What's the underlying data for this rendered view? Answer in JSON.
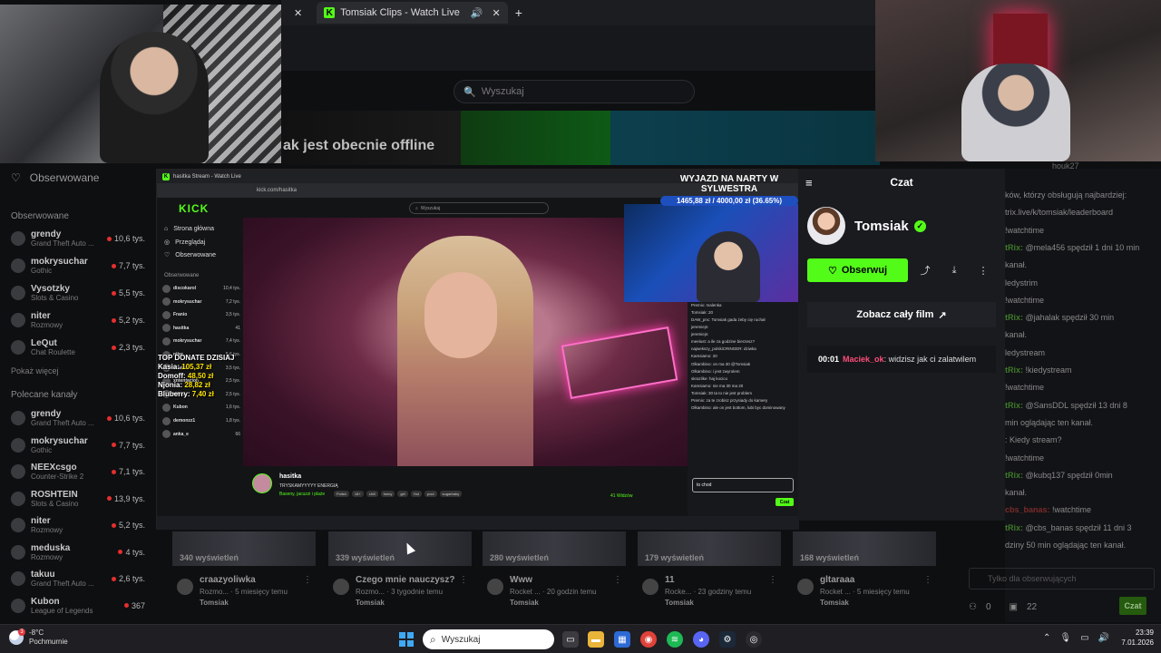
{
  "browser": {
    "tab_title": "Tomsiak Clips - Watch Live",
    "search_placeholder": "Wyszukaj",
    "offline_text": "ak jest obecnie offline"
  },
  "sidebar": {
    "following_header": "Obserwowane",
    "following_section": "Obserwowane",
    "following": [
      {
        "name": "grendy",
        "game": "Grand Theft Auto ...",
        "viewers": "10,6 tys."
      },
      {
        "name": "mokrysuchar",
        "game": "Gothic",
        "viewers": "7,7 tys."
      },
      {
        "name": "Vysotzky",
        "game": "Slots & Casino",
        "viewers": "5,5 tys."
      },
      {
        "name": "niter",
        "game": "Rozmowy",
        "viewers": "5,2 tys."
      },
      {
        "name": "LeQut",
        "game": "Chat Roulette",
        "viewers": "2,3 tys."
      }
    ],
    "show_more": "Pokaż więcej",
    "recommended_section": "Polecane kanały",
    "recommended": [
      {
        "name": "grendy",
        "game": "Grand Theft Auto ...",
        "viewers": "10,6 tys."
      },
      {
        "name": "mokrysuchar",
        "game": "Gothic",
        "viewers": "7,7 tys."
      },
      {
        "name": "NEEXcsgo",
        "game": "Counter-Strike 2",
        "viewers": "7,1 tys."
      },
      {
        "name": "ROSHTEIN",
        "game": "Slots & Casino",
        "viewers": "13,9 tys."
      },
      {
        "name": "niter",
        "game": "Rozmowy",
        "viewers": "5,2 tys."
      },
      {
        "name": "meduska",
        "game": "Rozmowy",
        "viewers": "4 tys."
      },
      {
        "name": "takuu",
        "game": "Grand Theft Auto ...",
        "viewers": "2,6 tys."
      },
      {
        "name": "Kubon",
        "game": "League of Legends",
        "viewers": "367"
      }
    ]
  },
  "inner": {
    "tab": "hasitka Stream - Watch Live",
    "url": "kick.com/hasitka",
    "logo": "KICK",
    "search": "Wyszukaj",
    "nav": [
      "Strona główna",
      "Przeglądaj",
      "Obserwowane"
    ],
    "section": "Obserwowane",
    "items": [
      {
        "name": "discokarol",
        "vw": "10,4 tys."
      },
      {
        "name": "mokrysuchar",
        "vw": "7,2 tys."
      },
      {
        "name": "Franio",
        "vw": "3,5 tys."
      },
      {
        "name": "hasitka",
        "vw": "41"
      },
      {
        "name": "mokrysuchar",
        "vw": "7,4 tys."
      },
      {
        "name": "niter",
        "vw": "5,6 tys."
      },
      {
        "name": "Franio",
        "vw": "3,5 tys."
      },
      {
        "name": "xntentacion",
        "vw": "2,5 tys."
      },
      {
        "name": "takuu",
        "vw": "2,5 tys."
      },
      {
        "name": "Kubon",
        "vw": "1,6 tys."
      },
      {
        "name": "demonzz1",
        "vw": "1,8 tys."
      },
      {
        "name": "anka_e",
        "vw": "66"
      }
    ],
    "streamer": "hasitka",
    "stream_title": "TRYSKAMYYYYY ENERGIĄ",
    "category": "Baseny, jacuzzi i plaże",
    "tags": [
      "Polish",
      "18+",
      "chill",
      "funny",
      "girl",
      "Hot",
      "pool",
      "sugarbaby"
    ],
    "viewers": "41 Widzów",
    "chat": [
      "Premix: malenka",
      "Tomsiak: 20",
      "DAW_pnc: Tomsiak gada żeby cię ruchał",
      "jeremiejn:",
      "jeremiejn:",
      "meelust: a ile za godzine bierzesz?",
      "najwekszy_polskiCRINGER: dziwka",
      "Kamsiamo: 20",
      "Olkambino: on ma 30 @Tomsiak",
      "Olkambino: i jest zwyrolem",
      "skrazlike: haj kocico",
      "Kamsiamo: nie ma 30 ma 20",
      "Tomsiak: 30 ta to nie jest problem",
      "Premix: za te zrobisz przysiady do kamery",
      "Olkambino: ale on jest bottom, lubi byc dominowany"
    ],
    "chat_input": "to chod",
    "chat_send": "Czat"
  },
  "donate": {
    "title": "TOP DONATE DZISIAJ",
    "rows": [
      {
        "name": "Kasia:",
        "value": "105,37 zł"
      },
      {
        "name": "Domoff:",
        "value": "48,50 zł"
      },
      {
        "name": "Njonia:",
        "value": "28,82 zł"
      },
      {
        "name": "Bluberry:",
        "value": "7,40 zł"
      }
    ]
  },
  "goal": {
    "title": "WYJAZD NA NARTY W SYLWESTRA",
    "progress_text": "1465,88 zł / 4000,00 zł (36.65%)"
  },
  "chatpanel": {
    "title": "Czat",
    "channel": "Tomsiak",
    "follow": "Obserwuj",
    "full_video": "Zobacz cały film",
    "message_time": "00:01",
    "message_user": "Maciek_ok",
    "message_text": ": widzisz jak ci zalatwilem"
  },
  "rightchat": {
    "user_top": "houk27",
    "lines": [
      {
        "u": "",
        "t": "ków, którzy obsługują najbardziej:"
      },
      {
        "u": "",
        "t": "trix.live/k/tomsiak/leaderboard"
      },
      {
        "u": "",
        "t": "!watchtime"
      },
      {
        "u": "tRix:",
        "t": " @mela456 spędził 1 dni 10 min"
      },
      {
        "u": "",
        "t": "kanał."
      },
      {
        "u": "",
        "t": "ledystrim"
      },
      {
        "u": "",
        "t": "!watchtime"
      },
      {
        "u": "tRix:",
        "t": " @jahalak spędził 30 min"
      },
      {
        "u": "",
        "t": "kanał."
      },
      {
        "u": "",
        "t": "ledystream"
      },
      {
        "u": "tRix:",
        "t": " !kiedystream"
      },
      {
        "u": "",
        "t": "!watchtime"
      },
      {
        "u": "tRix:",
        "t": " @SansDDL spędził 13 dni 8"
      },
      {
        "u": "",
        "t": "min oglądając ten kanał."
      },
      {
        "u": "",
        "t": ": Kiedy stream?"
      },
      {
        "u": "",
        "t": "!watchtime"
      },
      {
        "u": "tRix:",
        "t": " @kubq137 spędził 0min"
      },
      {
        "u": "",
        "t": "kanał."
      },
      {
        "u": "cbs_banas:",
        "t": " !watchtime"
      },
      {
        "u": "tRix:",
        "t": " @cbs_banas spędził 11 dni 3"
      },
      {
        "u": "",
        "t": "dziny 50 min oglądając ten kanał."
      }
    ],
    "input_placeholder": "Tylko dla obserwujących",
    "count_a": "0",
    "count_b": "22",
    "send": "Czat"
  },
  "clips": [
    {
      "views": "340 wyświetleń",
      "title": "craazyoliwka",
      "meta": "Rozmo... · 5 miesięcy temu",
      "author": "Tomsiak"
    },
    {
      "views": "339 wyświetleń",
      "title": "Czego mnie nauczysz?",
      "meta": "Rozmo... · 3 tygodnie temu",
      "author": "Tomsiak"
    },
    {
      "views": "280 wyświetleń",
      "title": "Www",
      "meta": "Rocket ... · 20 godzin temu",
      "author": "Tomsiak"
    },
    {
      "views": "179 wyświetleń",
      "title": "11",
      "meta": "Rocke... · 23 godziny temu",
      "author": "Tomsiak"
    },
    {
      "views": "168 wyświetleń",
      "title": "gltaraaa",
      "meta": "Rocket ... · 5 miesięcy temu",
      "author": "Tomsiak"
    }
  ],
  "taskbar": {
    "temp": "-8°C",
    "weather": "Pochmurnie",
    "weather_badge": "3",
    "search": "Wyszukaj",
    "time": "23:39",
    "date": "7.01.2026"
  },
  "colors": {
    "kick_green": "#53fc18",
    "goal_blue": "#1e4fbf",
    "chat_user_red": "#ff4d7a"
  }
}
